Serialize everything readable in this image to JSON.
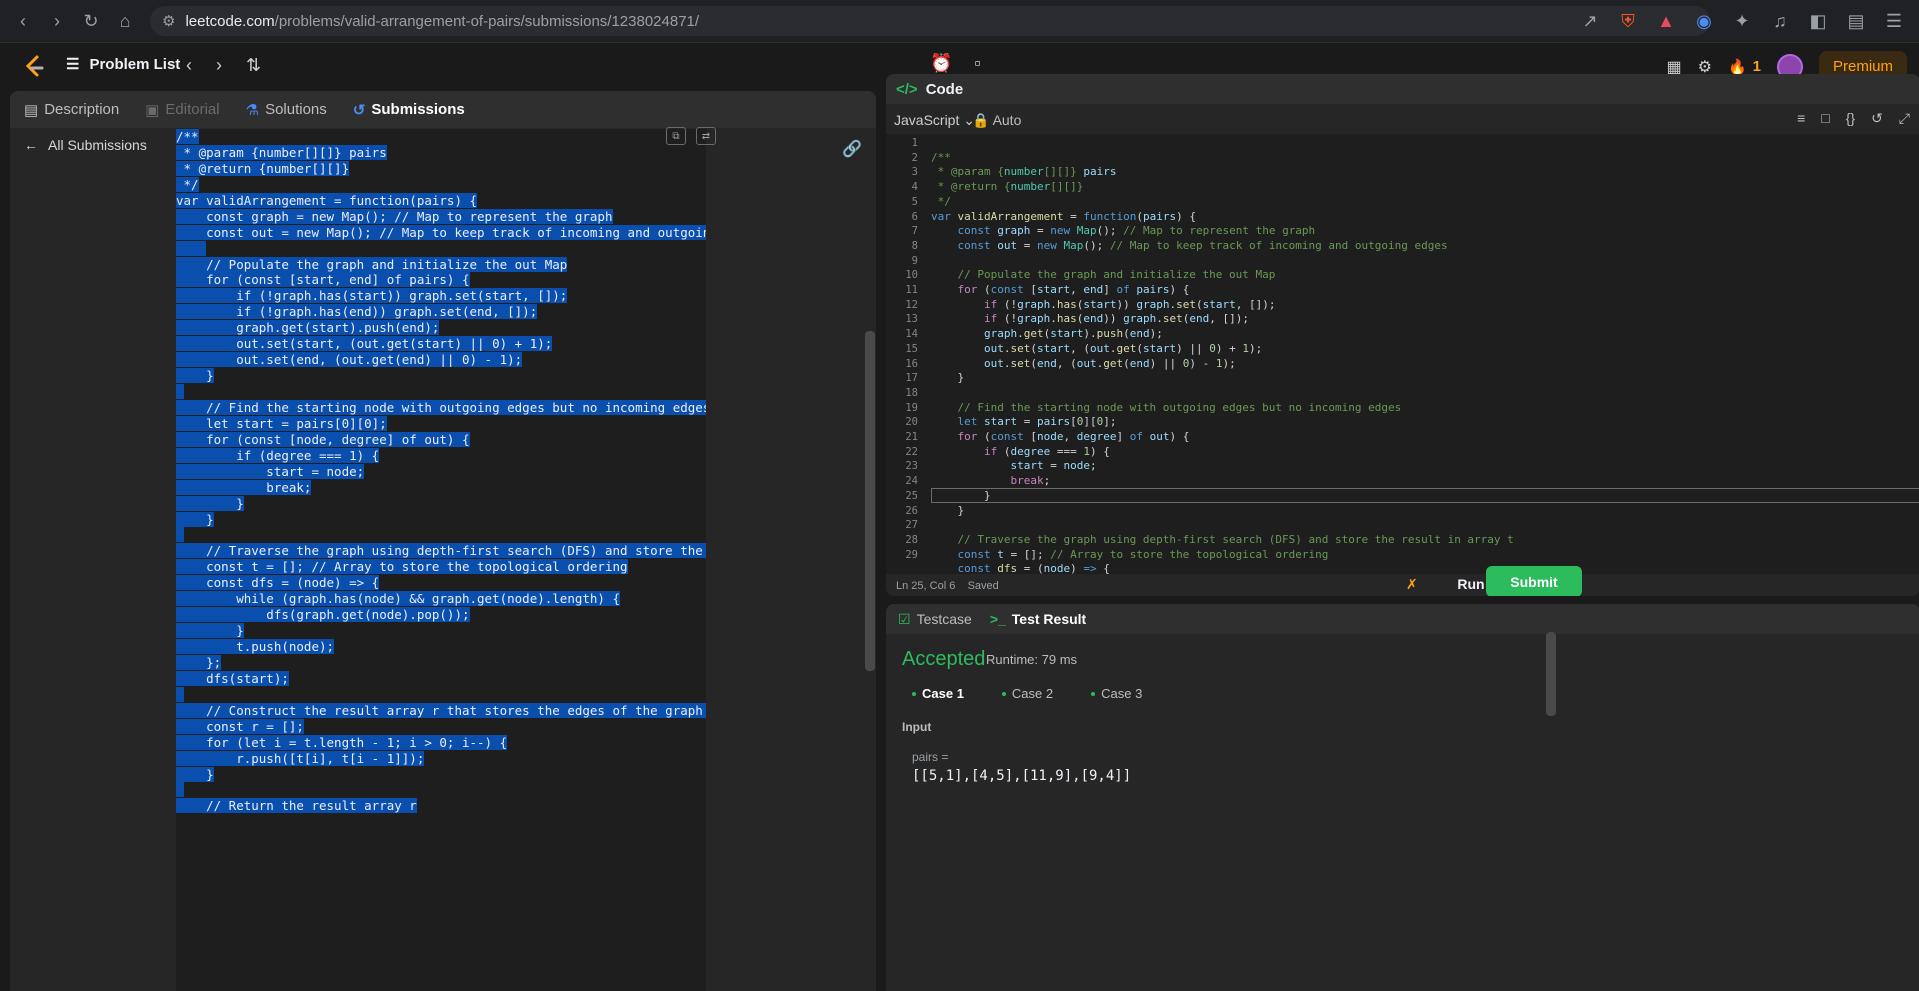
{
  "browser": {
    "url_host": "leetcode.com",
    "url_path": "/problems/valid-arrangement-of-pairs/submissions/1238024871/",
    "badge_count": "4"
  },
  "nav": {
    "problem_list": "Problem List",
    "streak": "1",
    "premium": "Premium"
  },
  "left": {
    "tabs": [
      "Description",
      "Editorial",
      "Solutions",
      "Submissions"
    ],
    "all_submissions": "All Submissions",
    "code_lines": [
      "/**",
      " * @param {number[][]} pairs",
      " * @return {number[][]}",
      " */",
      "var validArrangement = function(pairs) {",
      "    const graph = new Map(); // Map to represent the graph",
      "    const out = new Map(); // Map to keep track of incoming and outgoing edges",
      "    ",
      "    // Populate the graph and initialize the out Map",
      "    for (const [start, end] of pairs) {",
      "        if (!graph.has(start)) graph.set(start, []);",
      "        if (!graph.has(end)) graph.set(end, []);",
      "        graph.get(start).push(end);",
      "        out.set(start, (out.get(start) || 0) + 1);",
      "        out.set(end, (out.get(end) || 0) - 1);",
      "    }",
      "",
      "    // Find the starting node with outgoing edges but no incoming edges",
      "    let start = pairs[0][0];",
      "    for (const [node, degree] of out) {",
      "        if (degree === 1) {",
      "            start = node;",
      "            break;",
      "        }",
      "    }",
      "",
      "    // Traverse the graph using depth-first search (DFS) and store the result in array t",
      "    const t = []; // Array to store the topological ordering",
      "    const dfs = (node) => {",
      "        while (graph.has(node) && graph.get(node).length) {",
      "            dfs(graph.get(node).pop());",
      "        }",
      "        t.push(node);",
      "    };",
      "    dfs(start);",
      "",
      "    // Construct the result array r that stores the edges of the graph in topological order",
      "    const r = [];",
      "    for (let i = t.length - 1; i > 0; i--) {",
      "        r.push([t[i], t[i - 1]]);",
      "    }",
      "",
      "    // Return the result array r"
    ]
  },
  "editor": {
    "header": "Code",
    "language": "JavaScript",
    "mode": "Auto",
    "status": "Ln 25, Col 6",
    "saved": "Saved",
    "run": "Run",
    "submit": "Submit",
    "line_numbers": [
      "1",
      "2",
      "3",
      "4",
      "5",
      "6",
      "7",
      "8",
      "9",
      "10",
      "11",
      "12",
      "13",
      "14",
      "15",
      "16",
      "17",
      "18",
      "19",
      "20",
      "21",
      "22",
      "23",
      "24",
      "25",
      "26",
      "27",
      "28",
      "29"
    ]
  },
  "result": {
    "tabs": [
      "Testcase",
      "Test Result"
    ],
    "status": "Accepted",
    "runtime": "Runtime: 79 ms",
    "cases": [
      "Case 1",
      "Case 2",
      "Case 3"
    ],
    "input_label": "Input",
    "param_name": "pairs =",
    "param_value": "[[5,1],[4,5],[11,9],[9,4]]"
  }
}
